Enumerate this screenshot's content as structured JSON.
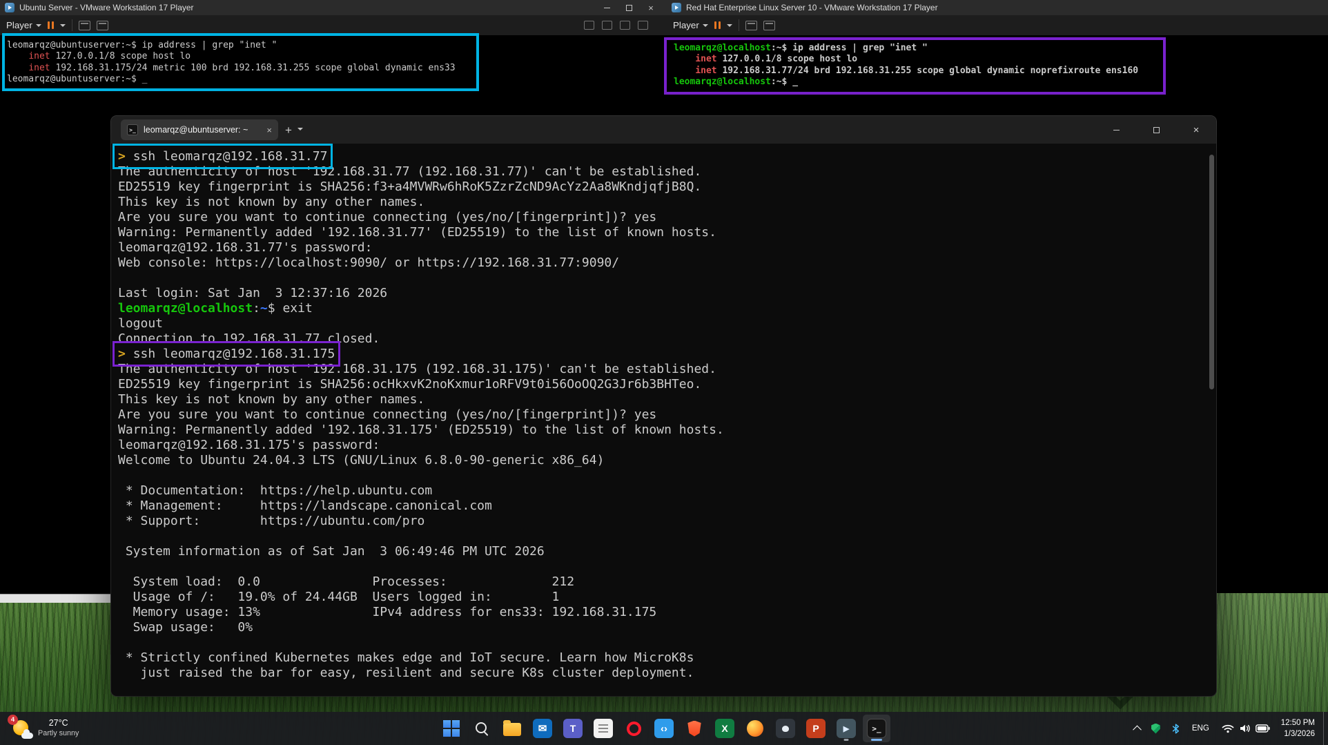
{
  "colors": {
    "highlight_cyan": "#00b4e4",
    "highlight_purple": "#7a22cf",
    "terminal_bg": "#0c0c0c",
    "terminal_fg": "#cccccc",
    "prompt_green": "#16c60c",
    "path_blue": "#3b78ff",
    "arrow_gold": "#d9a521",
    "inet_red": "#e05252",
    "suspend_orange": "#e87722",
    "taskbar_bg": "#1b1c20"
  },
  "glyphs": {
    "close": "×",
    "new_tab": "+"
  },
  "vm_left": {
    "title": "Ubuntu Server - VMware Workstation 17 Player",
    "player_menu": "Player",
    "terminal_lines": [
      "leomarqz@ubuntuserver:~$ ip address | grep \"inet \"",
      {
        "segs": [
          {
            "t": "    ",
            "c": "fg"
          },
          {
            "t": "inet",
            "c": "red"
          },
          {
            "t": " 127.0.0.1/8 scope host lo",
            "c": "fg"
          }
        ]
      },
      {
        "segs": [
          {
            "t": "    ",
            "c": "fg"
          },
          {
            "t": "inet",
            "c": "red"
          },
          {
            "t": " 192.168.31.175/24 metric 100 brd 192.168.31.255 scope global dynamic ens33",
            "c": "fg"
          }
        ]
      },
      "leomarqz@ubuntuserver:~$ _"
    ]
  },
  "vm_right": {
    "title": "Red Hat Enterprise Linux Server 10 - VMware Workstation 17 Player",
    "player_menu": "Player",
    "terminal_lines": [
      {
        "segs": [
          {
            "t": "leomarqz@localhost",
            "c": "green"
          },
          {
            "t": ":~$ ip address | grep \"inet \"",
            "c": "fg"
          }
        ]
      },
      {
        "segs": [
          {
            "t": "    ",
            "c": "fg"
          },
          {
            "t": "inet",
            "c": "red"
          },
          {
            "t": " 127.0.0.1/8 scope host lo",
            "c": "fg"
          }
        ]
      },
      {
        "segs": [
          {
            "t": "    ",
            "c": "fg"
          },
          {
            "t": "inet",
            "c": "red"
          },
          {
            "t": " 192.168.31.77/24 brd 192.168.31.255 scope global dynamic noprefixroute ens160",
            "c": "fg"
          }
        ]
      },
      {
        "segs": [
          {
            "t": "leomarqz@localhost",
            "c": "green"
          },
          {
            "t": ":~$ _",
            "c": "fg"
          }
        ]
      }
    ]
  },
  "terminal_window": {
    "tab_title": "leomarqz@ubuntuserver: ~",
    "lines": [
      {
        "hl": "cyan",
        "segs": [
          {
            "t": "> ",
            "c": "gold"
          },
          {
            "t": "ssh leomarqz@192.168.31.77",
            "c": "fg"
          }
        ]
      },
      "The authenticity of host '192.168.31.77 (192.168.31.77)' can't be established.",
      "ED25519 key fingerprint is SHA256:f3+a4MVWRw6hRoK5ZzrZcND9AcYz2Aa8WKndjqfjB8Q.",
      "This key is not known by any other names.",
      "Are you sure you want to continue connecting (yes/no/[fingerprint])? yes",
      "Warning: Permanently added '192.168.31.77' (ED25519) to the list of known hosts.",
      "leomarqz@192.168.31.77's password:",
      "Web console: https://localhost:9090/ or https://192.168.31.77:9090/",
      "",
      "Last login: Sat Jan  3 12:37:16 2026",
      {
        "segs": [
          {
            "t": "leomarqz@localhost",
            "c": "green"
          },
          {
            "t": ":",
            "c": "fg"
          },
          {
            "t": "~",
            "c": "blue"
          },
          {
            "t": "$ exit",
            "c": "fg"
          }
        ]
      },
      "logout",
      "Connection to 192.168.31.77 closed.",
      {
        "hl": "purple",
        "segs": [
          {
            "t": "> ",
            "c": "gold"
          },
          {
            "t": "ssh leomarqz@192.168.31.175",
            "c": "fg"
          }
        ]
      },
      "The authenticity of host '192.168.31.175 (192.168.31.175)' can't be established.",
      "ED25519 key fingerprint is SHA256:ocHkxvK2noKxmur1oRFV9t0i56OoOQ2G3Jr6b3BHTeo.",
      "This key is not known by any other names.",
      "Are you sure you want to continue connecting (yes/no/[fingerprint])? yes",
      "Warning: Permanently added '192.168.31.175' (ED25519) to the list of known hosts.",
      "leomarqz@192.168.31.175's password:",
      "Welcome to Ubuntu 24.04.3 LTS (GNU/Linux 6.8.0-90-generic x86_64)",
      "",
      " * Documentation:  https://help.ubuntu.com",
      " * Management:     https://landscape.canonical.com",
      " * Support:        https://ubuntu.com/pro",
      "",
      " System information as of Sat Jan  3 06:49:46 PM UTC 2026",
      "",
      "  System load:  0.0               Processes:              212",
      "  Usage of /:   19.0% of 24.44GB  Users logged in:        1",
      "  Memory usage: 13%               IPv4 address for ens33: 192.168.31.175",
      "  Swap usage:   0%",
      "",
      " * Strictly confined Kubernetes makes edge and IoT secure. Learn how MicroK8s",
      "   just raised the bar for easy, resilient and secure K8s cluster deployment."
    ]
  },
  "taskbar": {
    "weather": {
      "temperature": "27°C",
      "condition": "Partly sunny",
      "badge": "4"
    },
    "icons": [
      {
        "name": "start"
      },
      {
        "name": "search"
      },
      {
        "name": "file-explorer"
      },
      {
        "name": "outlook"
      },
      {
        "name": "teams"
      },
      {
        "name": "notepad"
      },
      {
        "name": "opera"
      },
      {
        "name": "vscode"
      },
      {
        "name": "brave"
      },
      {
        "name": "excel"
      },
      {
        "name": "firefox"
      },
      {
        "name": "github-desktop"
      },
      {
        "name": "powerpoint"
      },
      {
        "name": "vmware-workstation",
        "open": true
      },
      {
        "name": "terminal",
        "open": true,
        "active": true
      }
    ],
    "tray": {
      "language": "ENG",
      "time": "12:50 PM",
      "date": "1/3/2026"
    }
  }
}
